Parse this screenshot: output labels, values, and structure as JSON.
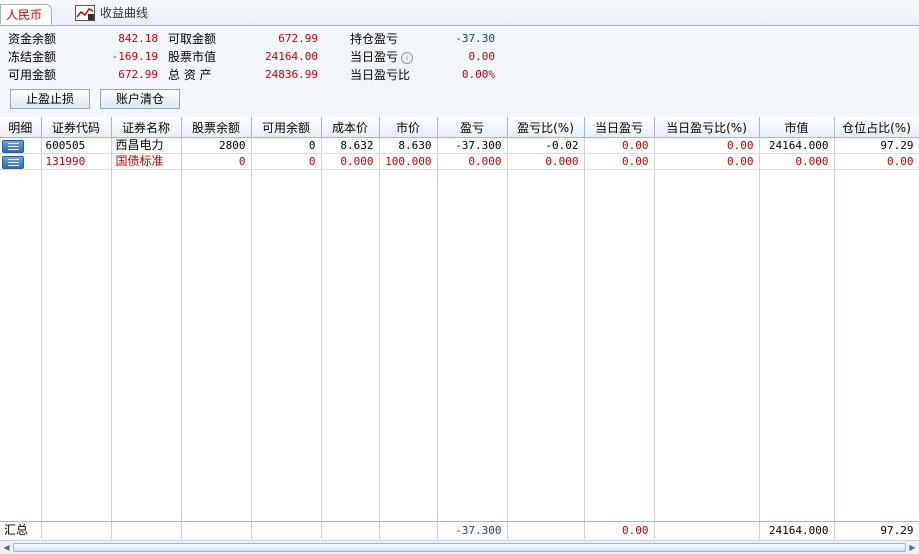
{
  "tabs": {
    "rmb": "人民币",
    "curve": "收益曲线"
  },
  "summary": {
    "fund_balance_label": "资金余额",
    "fund_balance": "842.18",
    "withdrawable_label": "可取金额",
    "withdrawable": "672.99",
    "holding_pl_label": "持仓盈亏",
    "holding_pl": "-37.30",
    "frozen_label": "冻结金额",
    "frozen": "-169.19",
    "stock_value_label": "股票市值",
    "stock_value": "24164.00",
    "today_pl_label": "当日盈亏",
    "today_pl": "0.00",
    "available_label": "可用金额",
    "available": "672.99",
    "total_assets_label": "总 资 产",
    "total_assets": "24836.99",
    "today_pl_ratio_label": "当日盈亏比",
    "today_pl_ratio": "0.00%"
  },
  "buttons": {
    "stop": "止盈止损",
    "clear": "账户清仓"
  },
  "columns": [
    "明细",
    "证券代码",
    "证券名称",
    "股票余额",
    "可用余额",
    "成本价",
    "市价",
    "盈亏",
    "盈亏比(%)",
    "当日盈亏",
    "当日盈亏比(%)",
    "市值",
    "仓位占比(%)"
  ],
  "rows": [
    {
      "code": "600505",
      "name": "西昌电力",
      "balance": "2800",
      "available": "0",
      "cost": "8.632",
      "price": "8.630",
      "pl": "-37.300",
      "pl_ratio": "-0.02",
      "today_pl": "0.00",
      "today_ratio": "0.00",
      "mv": "24164.000",
      "weight": "97.29"
    },
    {
      "code": "131990",
      "name": "国债标准",
      "balance": "0",
      "available": "0",
      "cost": "0.000",
      "price": "100.000",
      "pl": "0.000",
      "pl_ratio": "0.000",
      "today_pl": "0.00",
      "today_ratio": "0.00",
      "mv": "0.000",
      "weight": "0.00"
    }
  ],
  "footer": {
    "label": "汇总",
    "pl": "-37.300",
    "today_pl": "0.00",
    "mv": "24164.000",
    "weight": "97.29"
  },
  "colors": {
    "red": "#c00000",
    "blue": "#1f3a8c",
    "icon": "#2d68c4"
  }
}
